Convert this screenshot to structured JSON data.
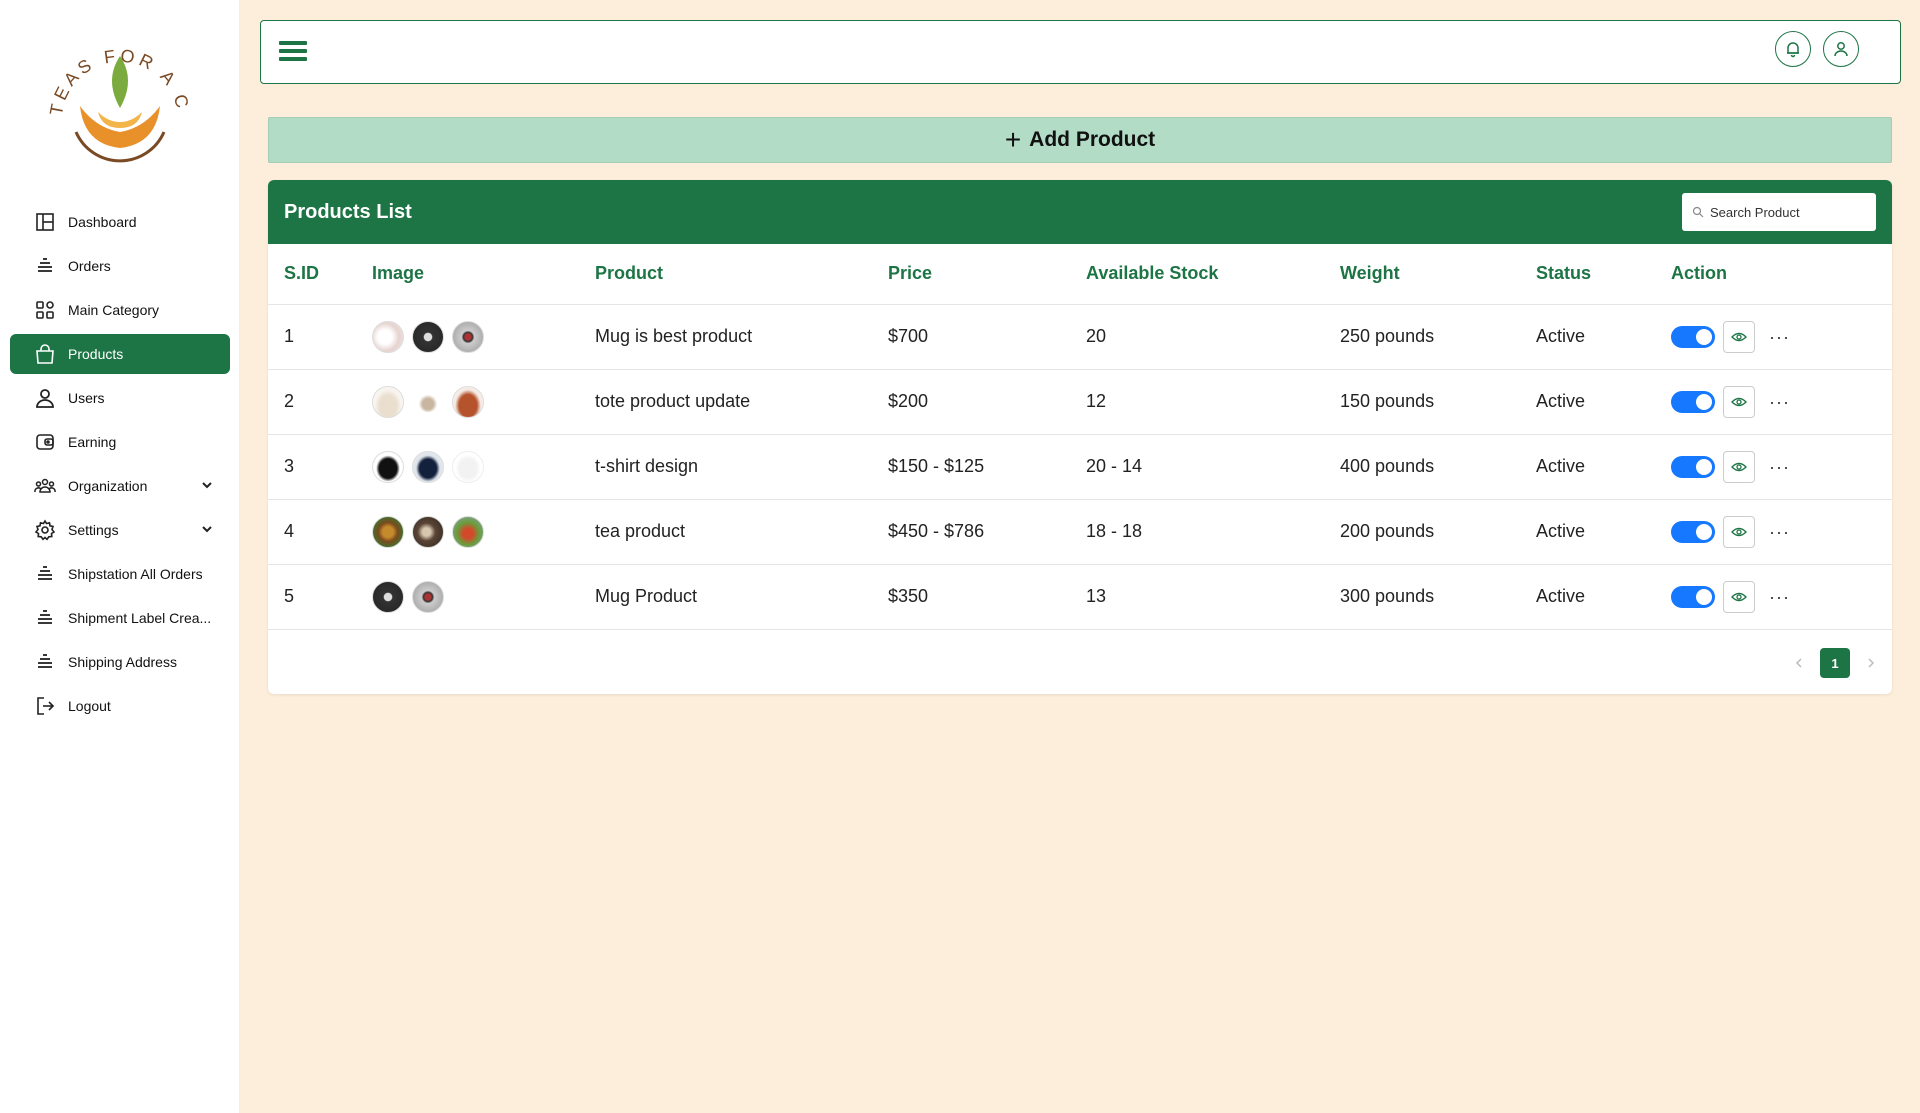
{
  "brand": {
    "logo_text": "TEAS FOR A CAUSE"
  },
  "sidebar": {
    "items": [
      {
        "label": "Dashboard",
        "icon": "dashboard-icon"
      },
      {
        "label": "Orders",
        "icon": "list-icon"
      },
      {
        "label": "Main Category",
        "icon": "category-grid-icon"
      },
      {
        "label": "Products",
        "icon": "shopping-bag-icon",
        "active": true
      },
      {
        "label": "Users",
        "icon": "user-icon"
      },
      {
        "label": "Earning",
        "icon": "wallet-icon"
      },
      {
        "label": "Organization",
        "icon": "organization-icon",
        "expandable": true
      },
      {
        "label": "Settings",
        "icon": "gear-icon",
        "expandable": true
      },
      {
        "label": "Shipstation All Orders",
        "icon": "list-icon"
      },
      {
        "label": "Shipment Label Crea...",
        "icon": "list-icon"
      },
      {
        "label": "Shipping Address",
        "icon": "list-icon"
      },
      {
        "label": "Logout",
        "icon": "logout-icon"
      }
    ]
  },
  "header": {
    "menu_icon": "hamburger-icon",
    "notification_icon": "bell-icon",
    "profile_icon": "user-icon"
  },
  "add_product": {
    "label": "Add Product"
  },
  "products": {
    "title": "Products List",
    "search_placeholder": "Search Product",
    "columns": [
      "S.ID",
      "Image",
      "Product",
      "Price",
      "Available Stock",
      "Weight",
      "Status",
      "Action"
    ],
    "rows": [
      {
        "id": "1",
        "product": "Mug is best product",
        "price": "$700",
        "stock": "20",
        "weight": "250 pounds",
        "status": "Active",
        "images": [
          "mug-white",
          "mug-black",
          "mug-photo"
        ]
      },
      {
        "id": "2",
        "product": "tote product update",
        "price": "$200",
        "stock": "12",
        "weight": "150 pounds",
        "status": "Active",
        "images": [
          "tote-beige",
          "tote-small",
          "tote-brown"
        ]
      },
      {
        "id": "3",
        "product": "t-shirt design",
        "price": "$150 - $125",
        "stock": "20 - 14",
        "weight": "400 pounds",
        "status": "Active",
        "images": [
          "tshirt-black",
          "tshirt-navy",
          "tshirt-white"
        ]
      },
      {
        "id": "4",
        "product": "tea product",
        "price": "$450 - $786",
        "stock": "18 - 18",
        "weight": "200 pounds",
        "status": "Active",
        "images": [
          "tea-1",
          "tea-2",
          "tea-3"
        ]
      },
      {
        "id": "5",
        "product": "Mug Product",
        "price": "$350",
        "stock": "13",
        "weight": "300 pounds",
        "status": "Active",
        "images": [
          "mug-black",
          "mug-photo"
        ]
      }
    ]
  },
  "pagination": {
    "current_page": "1"
  },
  "colors": {
    "primary": "#1d7445",
    "accent_light": "#b3dcc7",
    "page_bg": "#fdeedb",
    "toggle": "#1677ff"
  }
}
